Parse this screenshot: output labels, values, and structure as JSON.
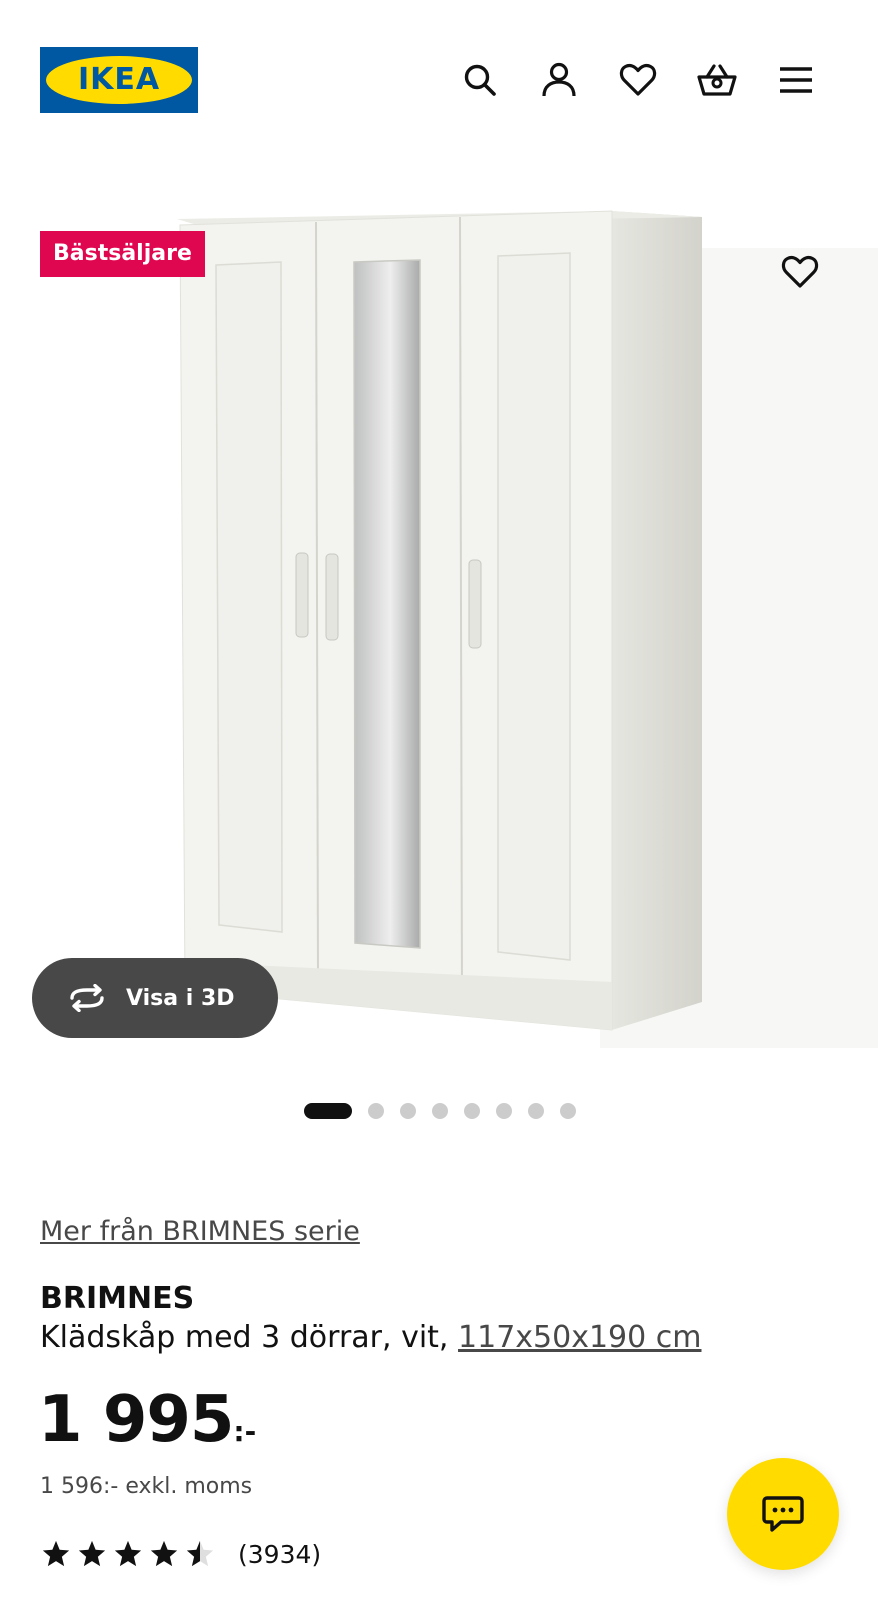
{
  "header": {
    "logo_text": "IKEA",
    "icons": [
      "search-icon",
      "user-icon",
      "heart-icon",
      "basket-icon",
      "menu-icon"
    ]
  },
  "gallery": {
    "badge": "Bästsäljare",
    "view_3d_label": "Visa i 3D",
    "slide_count": 8,
    "active_slide": 1
  },
  "product": {
    "series_link": "Mer från BRIMNES serie",
    "name": "BRIMNES",
    "description": "Klädskåp med 3 dörrar, vit,",
    "dimensions": "117x50x190 cm",
    "price": "1 995",
    "price_suffix": ":-",
    "price_excl_vat": "1 596:- exkl. moms",
    "rating": 4.5,
    "review_count": "(3934)"
  },
  "colors": {
    "ikea_blue": "#0058a3",
    "ikea_yellow": "#ffdb00",
    "badge_red": "#e00751"
  }
}
